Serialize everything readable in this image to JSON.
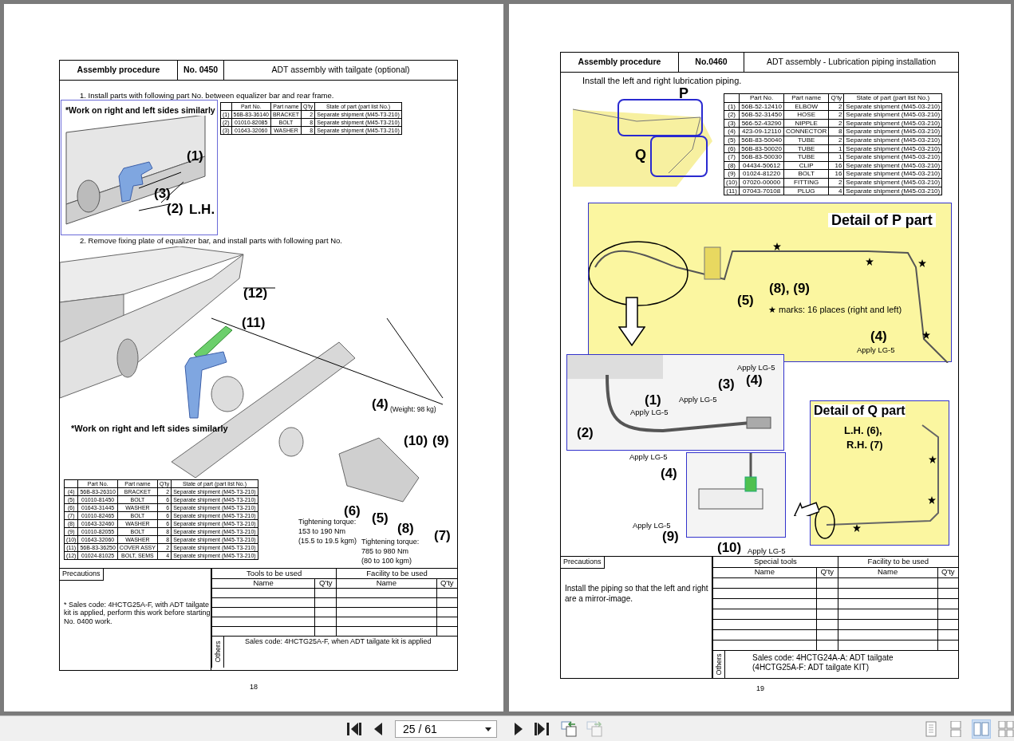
{
  "left_page": {
    "header": {
      "title": "Assembly procedure",
      "number": "No. 0450",
      "subject": "ADT assembly with tailgate (optional)"
    },
    "steps": [
      "1.  Install parts with following part No. between equalizer bar and rear frame.",
      "2.  Remove fixing plate of equalizer bar, and install parts with following part No."
    ],
    "figure_1": {
      "note": "*Work on right and left sides similarly",
      "callouts": [
        "(1)",
        "(3)",
        "(2)",
        "L.H."
      ]
    },
    "parts_table_1": {
      "columns": [
        "",
        "Part No.",
        "Part name",
        "Q'ty",
        "State of part (part list No.)"
      ],
      "rows": [
        [
          "(1)",
          "56B-83-36140",
          "BRACKET",
          "2",
          "Separate shipment (M45-T3-210)"
        ],
        [
          "(2)",
          "01010-82085",
          "BOLT",
          "8",
          "Separate shipment (M45-T3-210)"
        ],
        [
          "(3)",
          "01643-32060",
          "WASHER",
          "8",
          "Separate shipment (M45-T3-210)"
        ]
      ]
    },
    "figure_2": {
      "note": "*Work on right and left sides similarly",
      "callouts": [
        "(12)",
        "(11)",
        "(4)",
        "(10)",
        "(9)",
        "(6)",
        "(5)",
        "(8)",
        "(7)"
      ],
      "weight": "(Weight: 98 kg)",
      "torques": [
        [
          "Tightening torque:",
          "153 to 190 Nm",
          "(15.5 to 19.5 kgm)"
        ],
        [
          "Tightening torque:",
          "785 to 980 Nm",
          "(80 to 100 kgm)"
        ]
      ]
    },
    "parts_table_2": {
      "columns": [
        "",
        "Part No.",
        "Part name",
        "Q'ty",
        "State of part (part list No.)"
      ],
      "rows": [
        [
          "(4)",
          "56B-83-26310",
          "BRACKET",
          "2",
          "Separate shipment (M45-T3-210)"
        ],
        [
          "(5)",
          "01010-81450",
          "BOLT",
          "6",
          "Separate shipment (M45-T3-210)"
        ],
        [
          "(6)",
          "01643-31445",
          "WASHER",
          "6",
          "Separate shipment (M45-T3-210)"
        ],
        [
          "(7)",
          "01010-82465",
          "BOLT",
          "6",
          "Separate shipment (M45-T3-210)"
        ],
        [
          "(8)",
          "01643-32460",
          "WASHER",
          "6",
          "Separate shipment (M45-T3-210)"
        ],
        [
          "(9)",
          "01010-82055",
          "BOLT",
          "8",
          "Separate shipment (M45-T3-210)"
        ],
        [
          "(10)",
          "01643-32060",
          "WASHER",
          "8",
          "Separate shipment (M45-T3-210)"
        ],
        [
          "(11)",
          "56B-83-36250",
          "COVER ASSY",
          "2",
          "Separate shipment (M45-T3-210)"
        ],
        [
          "(12)",
          "01024-81025",
          "BOLT, SEMS",
          "4",
          "Separate shipment (M45-T3-210)"
        ]
      ]
    },
    "precautions": {
      "label": "Precautions",
      "text": "* Sales code: 4HCTG25A-F, with ADT tailgate kit is applied, perform this work before starting No. 0400 work."
    },
    "tools": {
      "groups": [
        "Tools to be used",
        "Facility to be used"
      ],
      "columns": [
        "Name",
        "Q'ty",
        "Name",
        "Q'ty"
      ]
    },
    "others": {
      "label": "Others",
      "text": "Sales code: 4HCTG25A-F, when ADT tailgate kit is applied"
    },
    "page_number": "18"
  },
  "right_page": {
    "header": {
      "title": "Assembly procedure",
      "number": "No.0460",
      "subject": "ADT assembly - Lubrication piping installation"
    },
    "intro": "Install the left and right lubrication piping.",
    "overview": {
      "labels": [
        "P",
        "Q"
      ]
    },
    "parts_table": {
      "columns": [
        "",
        "Part No.",
        "Part name",
        "Q'ty",
        "State of part (part list No.)"
      ],
      "rows": [
        [
          "(1)",
          "56B-52-12410",
          "ELBOW",
          "2",
          "Separate shipment (M45-03-210)"
        ],
        [
          "(2)",
          "56B-52-31450",
          "HOSE",
          "2",
          "Separate shipment (M45-03-210)"
        ],
        [
          "(3)",
          "566-52-43290",
          "NIPPLE",
          "2",
          "Separate shipment (M45-03-210)"
        ],
        [
          "(4)",
          "423-09-12110",
          "CONNECTOR",
          "8",
          "Separate shipment (M45-03-210)"
        ],
        [
          "(5)",
          "56B-83-50040",
          "TUBE",
          "2",
          "Separate shipment (M45-03-210)"
        ],
        [
          "(6)",
          "56B-83-50020",
          "TUBE",
          "1",
          "Separate shipment (M45-03-210)"
        ],
        [
          "(7)",
          "56B-83-50030",
          "TUBE",
          "1",
          "Separate shipment (M45-03-210)"
        ],
        [
          "(8)",
          "04434-50612",
          "CLIP",
          "16",
          "Separate shipment (M45-03-210)"
        ],
        [
          "(9)",
          "01024-81220",
          "BOLT",
          "16",
          "Separate shipment (M45-03-210)"
        ],
        [
          "(10)",
          "07020-00000",
          "FITTING",
          "2",
          "Separate shipment (M45-03-210)"
        ],
        [
          "(11)",
          "07043-70108",
          "PLUG",
          "4",
          "Separate shipment (M45-03-210)"
        ]
      ]
    },
    "detail_p": {
      "title": "Detail of P part",
      "callouts": [
        "(5)",
        "(8), (9)",
        "(4)"
      ],
      "legend": "★ marks: 16 places (right and left)",
      "apply": "Apply LG-5"
    },
    "detail_1": {
      "callouts": [
        "(4)",
        "(3)",
        "(1)",
        "(2)"
      ],
      "applies": [
        "Apply LG-5",
        "Apply LG-5",
        "Apply LG-5"
      ]
    },
    "detail_2": {
      "callouts": [
        "(4)",
        "(9)",
        "(10)"
      ],
      "applies": [
        "Apply LG-5",
        "Apply LG-5",
        "Apply LG-5"
      ]
    },
    "detail_q": {
      "title": "Detail of Q part",
      "lines": [
        "L.H. (6),",
        "R.H. (7)"
      ]
    },
    "precautions": {
      "label": "Precautions",
      "text": "Install the piping so that the left and right are a mirror-image."
    },
    "tools": {
      "groups": [
        "Special tools",
        "Facility to be used"
      ],
      "columns": [
        "Name",
        "Q'ty",
        "Name",
        "Q'ty"
      ]
    },
    "others": {
      "label": "Others",
      "lines": [
        "Sales code: 4HCTG24A-A: ADT tailgate",
        "(4HCTG25A-F: ADT tailgate KIT)"
      ]
    },
    "page_number": "19"
  },
  "toolbar": {
    "nav_left": [
      {
        "kind": "first",
        "disabled": false
      },
      {
        "kind": "prev",
        "disabled": false
      }
    ],
    "page_field": "25 / 61",
    "nav_right": [
      {
        "kind": "next",
        "disabled": false
      },
      {
        "kind": "last",
        "disabled": false
      },
      {
        "kind": "back",
        "disabled": false
      },
      {
        "kind": "forward",
        "disabled": true
      }
    ],
    "view_modes": [
      {
        "kind": "single",
        "selected": false
      },
      {
        "kind": "continuous",
        "selected": false
      },
      {
        "kind": "facing",
        "selected": true
      },
      {
        "kind": "facing_continuous",
        "selected": false
      }
    ]
  }
}
